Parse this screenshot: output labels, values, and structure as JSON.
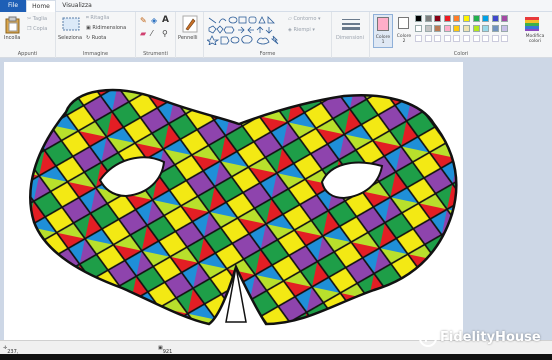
{
  "tabs": {
    "file": "File",
    "home": "Home",
    "view": "Visualizza"
  },
  "ribbon": {
    "clipboard": {
      "paste": "Incolla",
      "cut": "Taglia",
      "copy": "Copia",
      "group": "Appunti"
    },
    "image": {
      "select": "Seleziona",
      "crop": "Ritaglia",
      "resize": "Ridimensiona",
      "rotate": "Ruota",
      "group": "Immagine"
    },
    "tools": {
      "group": "Strumenti"
    },
    "brushes": {
      "label": "Pennelli"
    },
    "shapes": {
      "outline": "Contorno",
      "fill": "Riempi",
      "group": "Forme"
    },
    "size": {
      "label": "Dimensioni"
    },
    "colors": {
      "color1": "Colore 1",
      "color2": "Colore 2",
      "edit": "Modifica colori",
      "group": "Colori",
      "palette": [
        "#000000",
        "#7f7f7f",
        "#880015",
        "#ed1c24",
        "#ff7f27",
        "#fff200",
        "#22b14c",
        "#00a2e8",
        "#3f48cc",
        "#a349a4",
        "#ffffff",
        "#c3c3c3",
        "#b97a57",
        "#ffaec9",
        "#ffc90e",
        "#efe4b0",
        "#b5e61d",
        "#99d9ea",
        "#7092be",
        "#c8bfe7"
      ],
      "color1_value": "#ffaec9",
      "color2_value": "#ffffff"
    }
  },
  "status": {
    "cursor": "237, 141 pixel",
    "size": "921 × 548 pixel"
  },
  "watermark": "FidelityHouse"
}
